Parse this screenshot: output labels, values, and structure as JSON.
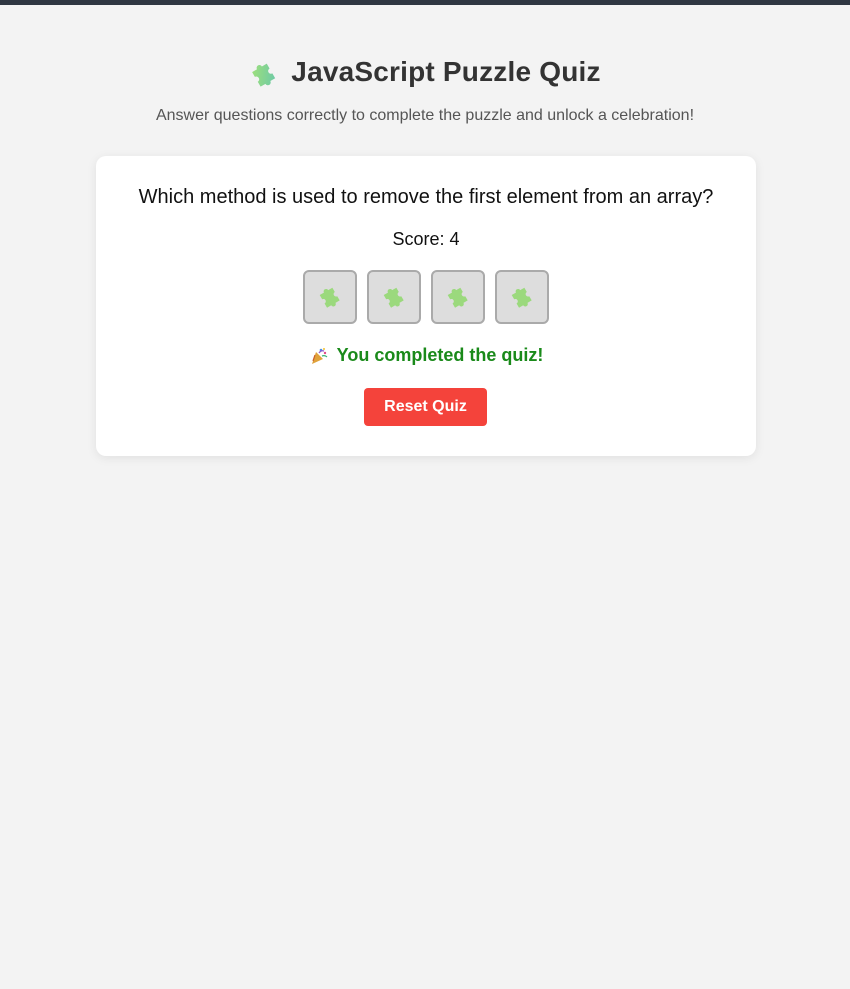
{
  "header": {
    "icon": "puzzle-piece-icon",
    "title": "JavaScript Puzzle Quiz",
    "subtitle": "Answer questions correctly to complete the puzzle and unlock a celebration!"
  },
  "quiz": {
    "question": "Which method is used to remove the first element from an array?",
    "score": "Score: 4",
    "pieces": [
      {
        "icon": "puzzle-piece-icon"
      },
      {
        "icon": "puzzle-piece-icon"
      },
      {
        "icon": "puzzle-piece-icon"
      },
      {
        "icon": "puzzle-piece-icon"
      }
    ],
    "completion_icon": "party-popper-icon",
    "completion_message": "You completed the quiz!",
    "reset_label": "Reset Quiz"
  },
  "colors": {
    "top_bar": "#2f3742",
    "background": "#f3f3f3",
    "success": "#1a8a1a",
    "reset_button": "#f4433b",
    "piece_fill": "#dddddd"
  }
}
